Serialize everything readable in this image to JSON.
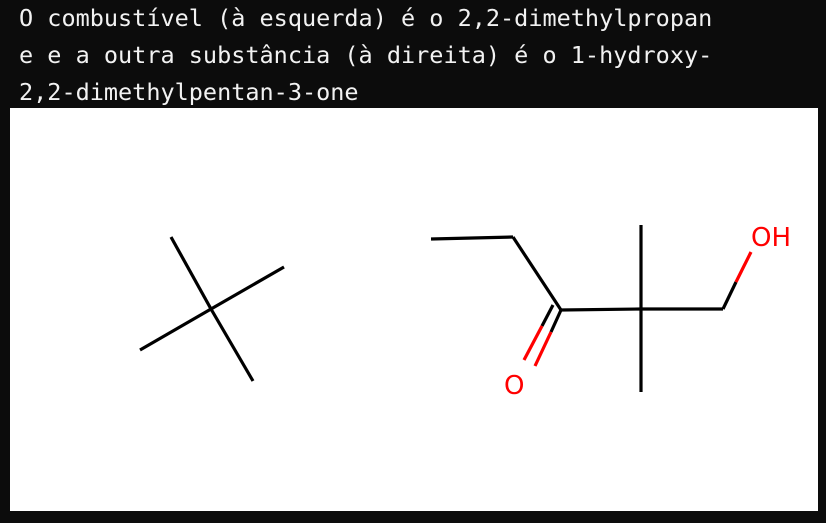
{
  "caption": {
    "line1": "O combustível (à esquerda) é o 2,2-dimethylpropan",
    "line2": "e e a outra substância (à direita) é o 1-hydroxy-",
    "line3": "2,2-dimethylpentan-3-one"
  },
  "structures": {
    "right": {
      "oxygen_label": "O",
      "hydroxyl_label": "OH"
    }
  },
  "colors": {
    "background": "#0c0c0c",
    "caption_text": "#f2f2f2",
    "figure_background": "#ffffff",
    "bond": "#000000",
    "heteroatom": "#ff0000"
  }
}
